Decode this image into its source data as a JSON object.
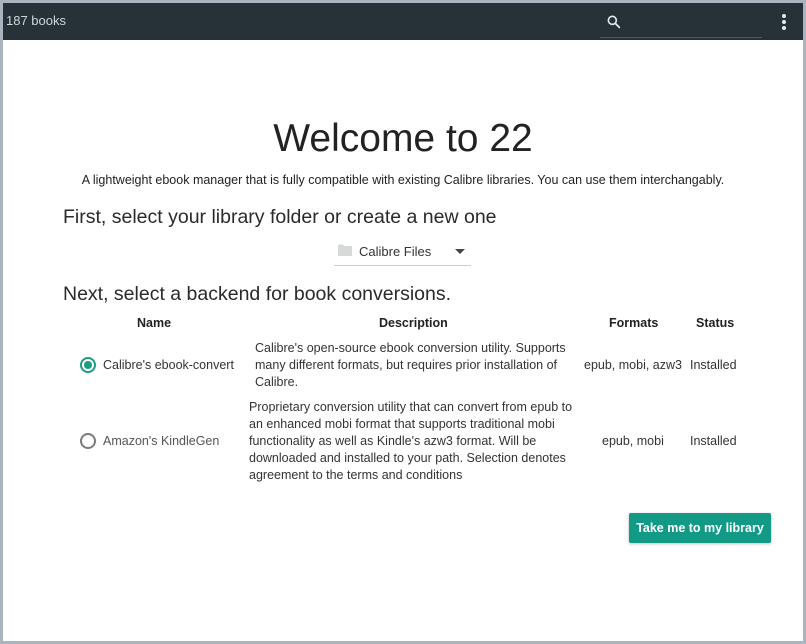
{
  "header": {
    "book_count": "187 books",
    "search": {
      "placeholder": ""
    }
  },
  "main": {
    "title": "Welcome to 22",
    "subtitle": "A lightweight ebook manager that is fully compatible with existing Calibre libraries. You can use them interchangably.",
    "library_heading": "First, select your library folder or create a new one",
    "library_folder": "Calibre Files",
    "backend_heading": "Next, select a backend for book conversions.",
    "table": {
      "columns": [
        "Name",
        "Description",
        "Formats",
        "Status"
      ],
      "rows": [
        {
          "selected": true,
          "name": "Calibre's ebook-convert",
          "description": "Calibre's open-source ebook conversion utility. Supports many different formats, but requires prior installation of Calibre.",
          "formats": "epub, mobi, azw3",
          "status": "Installed"
        },
        {
          "selected": false,
          "name": "Amazon's KindleGen",
          "description": "Proprietary conversion utility that can convert from epub to an enhanced mobi format that supports traditional mobi functionality as well as Kindle's azw3 format. Will be downloaded and installed to your path. Selection denotes agreement to the terms and conditions",
          "formats": "epub, mobi",
          "status": "Installed"
        }
      ]
    },
    "primary_button": "Take me to my library"
  },
  "colors": {
    "topbar": "#263238",
    "accent": "#129a87",
    "radio_checked": "#1e9b85"
  },
  "icons": [
    "search-icon",
    "more-vert-icon",
    "folder-icon",
    "dropdown-arrow-icon"
  ]
}
